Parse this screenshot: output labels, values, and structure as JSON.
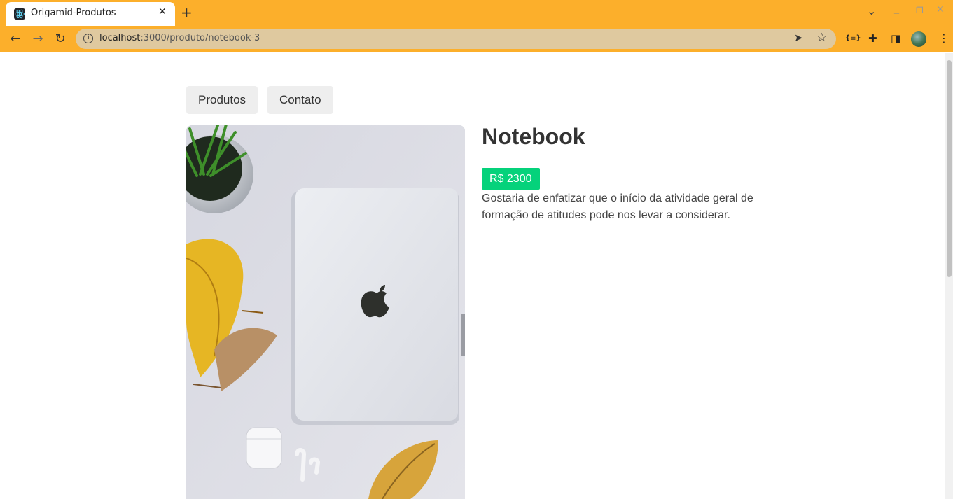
{
  "browser": {
    "tab_title": "Origamid-Produtos",
    "tab_close": "✕",
    "new_tab": "+",
    "url_host": "localhost",
    "url_path": ":3000/produto/notebook-3",
    "back": "←",
    "forward": "→",
    "reload": "↻",
    "send_icon": "➤",
    "star_icon": "☆",
    "ext_json_icon": "{≡}",
    "extensions_icon": "✚",
    "sidepanel_icon": "◨",
    "menu_icon": "⋮",
    "chevron": "⌄",
    "minimize": "_",
    "restore": "❐"
  },
  "nav": {
    "produtos": "Produtos",
    "contato": "Contato"
  },
  "product": {
    "name": "Notebook",
    "price": "R$ 2300",
    "description": "Gostaria de enfatizar que o início da atividade geral de formação de atitudes pode nos levar a considerar."
  },
  "colors": {
    "chrome": "#FCAF2B",
    "price_badge": "#05D27B"
  }
}
